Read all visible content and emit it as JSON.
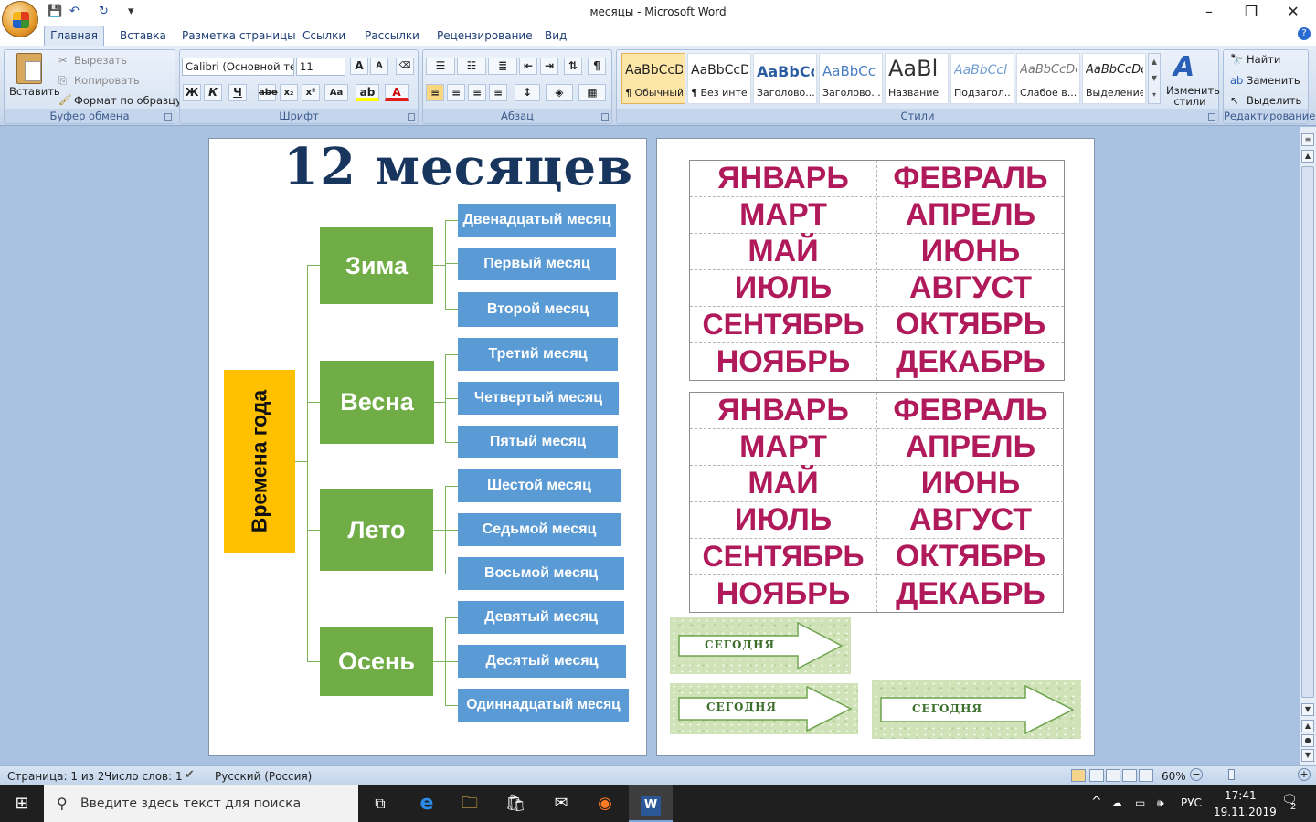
{
  "window": {
    "title": "месяцы - Microsoft Word",
    "minimize": "–",
    "maximize": "❐",
    "close": "✕"
  },
  "qat": {
    "save": "💾",
    "undo": "↶",
    "redo": "↻",
    "more": "▾"
  },
  "tabs": [
    "Главная",
    "Вставка",
    "Разметка страницы",
    "Ссылки",
    "Рассылки",
    "Рецензирование",
    "Вид"
  ],
  "clipboard": {
    "paste": "Вставить",
    "cut": "Вырезать",
    "copy": "Копировать",
    "format_painter": "Формат по образцу",
    "label": "Буфер обмена"
  },
  "font": {
    "name": "Calibri (Основной те",
    "size": "11",
    "label": "Шрифт",
    "bold": "Ж",
    "italic": "К",
    "underline": "Ч",
    "strike": "abe",
    "sub": "x₂",
    "sup": "x²",
    "case": "Aa",
    "grow": "A",
    "shrink": "A"
  },
  "paragraph": {
    "label": "Абзац",
    "pilcrow": "¶"
  },
  "styles": {
    "label": "Стили",
    "items": [
      {
        "preview": "AaBbCcDc",
        "name": "¶ Обычный"
      },
      {
        "preview": "AaBbCcDc",
        "name": "¶ Без инте..."
      },
      {
        "preview": "AaBbCc",
        "name": "Заголово..."
      },
      {
        "preview": "AaBbCc",
        "name": "Заголово..."
      },
      {
        "preview": "AaBl",
        "name": "Название"
      },
      {
        "preview": "AaBbCcl",
        "name": "Подзагол..."
      },
      {
        "preview": "AaBbCcDc",
        "name": "Слабое в..."
      },
      {
        "preview": "AaBbCcDc",
        "name": "Выделение"
      }
    ],
    "change": "Изменить стили"
  },
  "editing": {
    "label": "Редактирование",
    "find": "Найти",
    "replace": "Заменить",
    "select": "Выделить"
  },
  "page1": {
    "title": "12 месяцев",
    "year": "Времена года",
    "seasons": [
      {
        "name": "Зима",
        "months": [
          "Двенадцатый месяц",
          "Первый месяц",
          "Второй месяц"
        ]
      },
      {
        "name": "Весна",
        "months": [
          "Третий месяц",
          "Четвертый месяц",
          "Пятый месяц"
        ]
      },
      {
        "name": "Лето",
        "months": [
          "Шестой месяц",
          "Седьмой месяц",
          "Восьмой месяц"
        ]
      },
      {
        "name": "Осень",
        "months": [
          "Девятый месяц",
          "Десятый месяц",
          "Одиннадцатый месяц"
        ]
      }
    ]
  },
  "page2": {
    "table1": [
      "ЯНВАРЬ",
      "ФЕВРАЛЬ",
      "МАРТ",
      "АПРЕЛЬ",
      "МАЙ",
      "ИЮНЬ",
      "ИЮЛЬ",
      "АВГУСТ",
      "СЕНТЯБРЬ",
      "ОКТЯБРЬ",
      "НОЯБРЬ",
      "ДЕКАБРЬ"
    ],
    "table2": [
      "ЯНВАРЬ",
      "ФЕВРАЛЬ",
      "МАРТ",
      "АПРЕЛЬ",
      "МАЙ",
      "ИЮНЬ",
      "ИЮЛЬ",
      "АВГУСТ",
      "СЕНТЯБРЬ",
      "ОКТЯБРЬ",
      "НОЯБРЬ",
      "ДЕКАБРЬ"
    ],
    "arrows": [
      "СЕГОДНЯ",
      "СЕГОДНЯ",
      "СЕГОДНЯ"
    ]
  },
  "status": {
    "page": "Страница: 1 из 2",
    "words": "Число слов: 1",
    "lang": "Русский (Россия)",
    "zoom": "60%"
  },
  "taskbar": {
    "search": "Введите здесь текст для поиска",
    "lang": "РУС",
    "time": "17:41",
    "date": "19.11.2019",
    "notif": "2"
  },
  "colors": {
    "season": "#70ad47",
    "month": "#5b9bd5",
    "year": "#ffc000",
    "monthtext": "#b0195a",
    "title": "#18355e"
  }
}
